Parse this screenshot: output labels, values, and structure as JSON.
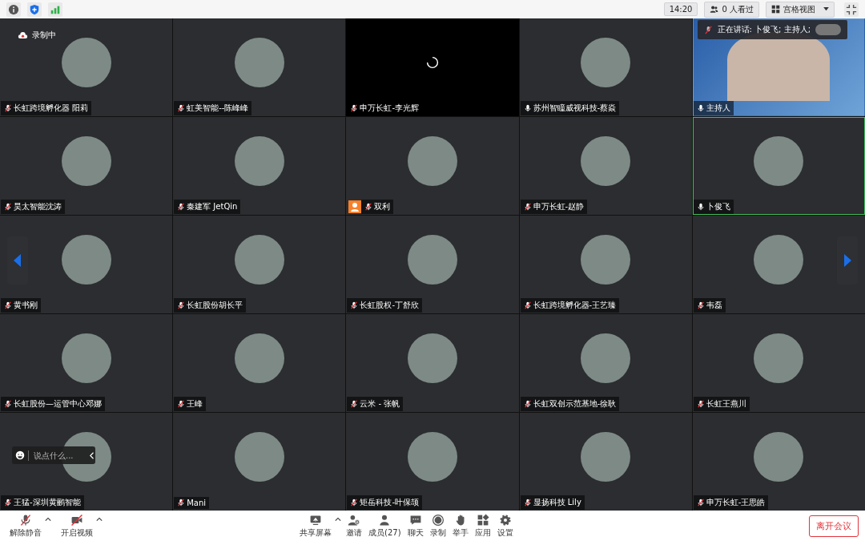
{
  "top_bar": {
    "time": "14:20",
    "viewers": "0 人看过",
    "view_mode": "宫格视图"
  },
  "recording": "录制中",
  "speaking_notice": "正在讲话: 卜俊飞; 主持人;",
  "chat": {
    "placeholder": "说点什么..."
  },
  "tiles": [
    {
      "name": "长虹跨境孵化器 阳莉",
      "kind": "avatar",
      "muted": true,
      "speaking": false
    },
    {
      "name": "虹美智能--陈峰峰",
      "kind": "avatar",
      "muted": true,
      "speaking": false
    },
    {
      "name": "申万长虹-李光辉",
      "kind": "loading",
      "muted": true,
      "speaking": false
    },
    {
      "name": "苏州智瞳威视科技-蔡焱",
      "kind": "avatar",
      "muted": false,
      "speaking": false
    },
    {
      "name": "主持人",
      "kind": "video",
      "muted": false,
      "speaking": false
    },
    {
      "name": "昊太智能沈涛",
      "kind": "avatar",
      "muted": true,
      "speaking": false
    },
    {
      "name": "秦建军 JetQin",
      "kind": "avatar",
      "muted": true,
      "speaking": false
    },
    {
      "name": "双利",
      "kind": "avatar",
      "muted": true,
      "speaking": false,
      "default_icon": true
    },
    {
      "name": "申万长虹-赵静",
      "kind": "avatar",
      "muted": true,
      "speaking": false
    },
    {
      "name": "卜俊飞",
      "kind": "avatar",
      "muted": false,
      "speaking": true
    },
    {
      "name": "黄书刚",
      "kind": "avatar",
      "muted": true,
      "speaking": false
    },
    {
      "name": "长虹股份胡长平",
      "kind": "avatar",
      "muted": true,
      "speaking": false
    },
    {
      "name": "长虹股权-丁舒欣",
      "kind": "avatar",
      "muted": true,
      "speaking": false
    },
    {
      "name": "长虹跨境孵化器-王艺臻",
      "kind": "avatar",
      "muted": true,
      "speaking": false
    },
    {
      "name": "韦磊",
      "kind": "avatar",
      "muted": true,
      "speaking": false
    },
    {
      "name": "长虹股份—运管中心邓娜",
      "kind": "avatar",
      "muted": true,
      "speaking": false
    },
    {
      "name": "王峰",
      "kind": "avatar",
      "muted": true,
      "speaking": false
    },
    {
      "name": "云米 - 张帆",
      "kind": "avatar",
      "muted": true,
      "speaking": false
    },
    {
      "name": "长虹双创示范基地-徐耿",
      "kind": "avatar",
      "muted": true,
      "speaking": false
    },
    {
      "name": "长虹王燕川",
      "kind": "avatar",
      "muted": true,
      "speaking": false
    },
    {
      "name": "王猛-深圳黄鹂智能",
      "kind": "avatar",
      "muted": true,
      "speaking": false
    },
    {
      "name": "Mani",
      "kind": "avatar",
      "muted": true,
      "speaking": false
    },
    {
      "name": "矩岳科技-叶保颉",
      "kind": "avatar",
      "muted": true,
      "speaking": false
    },
    {
      "name": "显扬科技 Lily",
      "kind": "avatar",
      "muted": true,
      "speaking": false
    },
    {
      "name": "申万长虹-王思皓",
      "kind": "avatar",
      "muted": true,
      "speaking": false
    }
  ],
  "toolbar": [
    {
      "label": "解除静音",
      "kind": "mic"
    },
    {
      "label": "开启视频",
      "kind": "video"
    },
    {
      "label": "共享屏幕",
      "kind": "share"
    },
    {
      "label": "邀请",
      "kind": "invite"
    },
    {
      "label": "成员(27)",
      "kind": "members"
    },
    {
      "label": "聊天",
      "kind": "chat"
    },
    {
      "label": "录制",
      "kind": "record"
    },
    {
      "label": "举手",
      "kind": "hand"
    },
    {
      "label": "应用",
      "kind": "apps"
    },
    {
      "label": "设置",
      "kind": "settings"
    }
  ],
  "leave_button": "离开会议"
}
